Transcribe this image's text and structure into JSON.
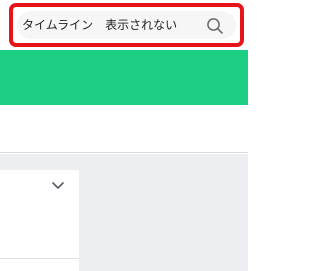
{
  "search": {
    "text": "タイムライン　表示されない",
    "icon": "search-icon"
  },
  "colors": {
    "highlight_border": "#e8141c",
    "banner": "#1ccd84",
    "content_background": "#eceef1"
  },
  "card": {
    "icon": "chevron-down-icon"
  }
}
